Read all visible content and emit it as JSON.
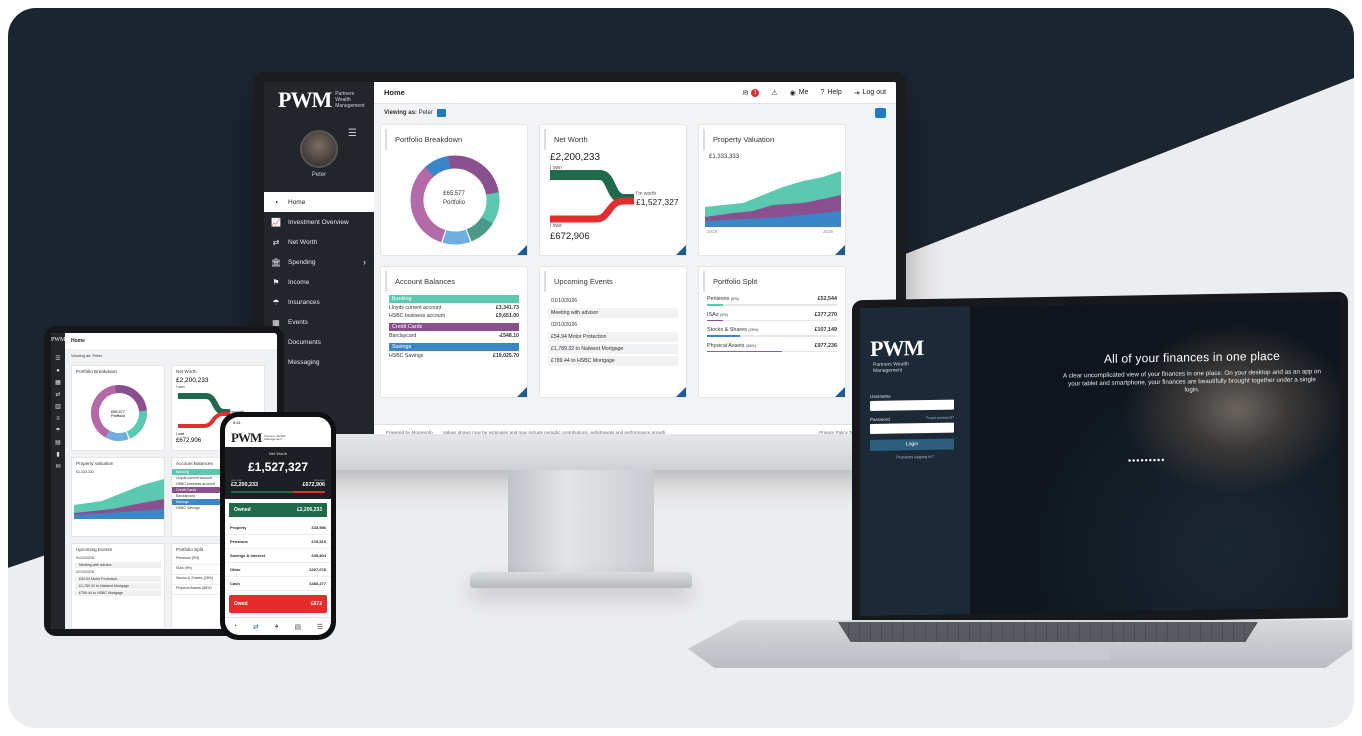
{
  "brand": {
    "logo": "PWM",
    "logo_sub": "Partners Wealth Management"
  },
  "monitor": {
    "top": {
      "title": "Home",
      "badge": "1",
      "me": "Me",
      "help": "Help",
      "logout": "Log out"
    },
    "viewing": {
      "label": "Viewing as:",
      "user": "Peter"
    },
    "user_name": "Peter",
    "nav": [
      {
        "label": "Home",
        "icon": "dashboard-icon"
      },
      {
        "label": "Investment Overview",
        "icon": "chart-line-icon"
      },
      {
        "label": "Net Worth",
        "icon": "transfer-icon"
      },
      {
        "label": "Spending",
        "icon": "bank-icon"
      },
      {
        "label": "Income",
        "icon": "signpost-icon"
      },
      {
        "label": "Insurances",
        "icon": "umbrella-icon"
      },
      {
        "label": "Events",
        "icon": "calendar-icon"
      },
      {
        "label": "Documents",
        "icon": "document-icon"
      },
      {
        "label": "Messaging",
        "icon": "message-icon"
      }
    ],
    "portfolio": {
      "title": "Portfolio Breakdown",
      "amount": "£65,577",
      "label": "Portfolio"
    },
    "networth": {
      "title": "Net Worth",
      "own_value": "£2,200,233",
      "own_label": "I own",
      "worth_label": "I'm worth",
      "worth_value": "£1,527,327",
      "owe_label": "I owe",
      "owe_value": "£672,906"
    },
    "property": {
      "title": "Property Valuation",
      "value": "£1,333,333",
      "start": "2019",
      "end": "2026"
    },
    "balances": {
      "title": "Account Balances",
      "groups": [
        {
          "name": "Banking",
          "color": "#5bc8b0",
          "rows": [
            [
              "Lloyds current account",
              "£3,341.73"
            ],
            [
              "HSBC business account",
              "£9,651.00"
            ]
          ]
        },
        {
          "name": "Credit Cards",
          "color": "#8a4f8f",
          "rows": [
            [
              "Barclaycard",
              "-£548.10"
            ]
          ]
        },
        {
          "name": "Savings",
          "color": "#3a86c8",
          "rows": [
            [
              "HSBC Savings",
              "£19,025.70"
            ]
          ]
        }
      ]
    },
    "events": {
      "title": "Upcoming Events",
      "items": [
        {
          "text": "01/10/2026",
          "box": false
        },
        {
          "text": "Meeting with advisor",
          "box": true
        },
        {
          "text": "02/10/2026",
          "box": false
        },
        {
          "text": "£54.94 Motor Protection",
          "box": true
        },
        {
          "text": "£1,789.32 to Natwest Mortgage",
          "box": true
        },
        {
          "text": "£789.44 to HSBC Mortgage",
          "box": true
        }
      ]
    },
    "split": {
      "title": "Portfolio Split",
      "items": [
        {
          "label": "Pensions",
          "pct": "(5%)",
          "value": "£52,544",
          "fill": 0.05,
          "color": "#5bc8b0"
        },
        {
          "label": "ISAs",
          "pct": "(9%)",
          "value": "£377,270",
          "fill": 0.09,
          "color": "#8a4f8f"
        },
        {
          "label": "Stocks & Shares",
          "pct": "(25%)",
          "value": "£107,149",
          "fill": 0.25,
          "color": "#3a86c8"
        },
        {
          "label": "Physical Assets",
          "pct": "(58%)",
          "value": "£977,236",
          "fill": 0.58,
          "color": "#a7539d"
        }
      ]
    },
    "footer": {
      "powered": "Powered by Moneyinfo",
      "disclaimer": "Values shown may be estimates and may include periodic contributions, withdrawals and performance growth",
      "links": "Privacy Policy  Terms & Conditio"
    }
  },
  "laptop": {
    "username_label": "Username",
    "password_label": "Password",
    "forgot": "Forgot password?",
    "login": "Login",
    "register": "Problems logging in?",
    "hero_title": "All of your finances in one place",
    "hero_text": "A clear uncomplicated view of your finances in one place. On your desktop and as an app on your tablet and smartphone, your finances are beautifully brought together under a single login.",
    "dots": "•••••••••"
  },
  "tablet": {
    "title": "Home",
    "viewing": "Viewing as: Peter",
    "portfolio_title": "Portfolio Breakdown",
    "portfolio_amount": "£65,577",
    "portfolio_label": "Portfolio",
    "networth_title": "Net Worth",
    "networth_value": "£2,200,233",
    "networth_own": "I own",
    "networth_worth": "I'm worth",
    "networth_owe": "I owe",
    "networth_owe_value": "£672,906",
    "property_title": "Property Valuation",
    "property_value": "£1,333,333",
    "balances_title": "Account Balances",
    "balances_rows": [
      "Banking",
      "Lloyds current account",
      "HSBC business account",
      "Credit Cards",
      "Barclaycard",
      "Savings",
      "HSBC Savings"
    ],
    "events_title": "Upcoming Events",
    "events_rows": [
      "01/10/2026",
      "Meeting with advisor",
      "02/10/2026",
      "£54.94 Motor Protection",
      "£1,789.32 to Natwest Mortgage",
      "£789.44 to HSBC Mortgage"
    ],
    "split_title": "Portfolio Split",
    "split_rows": [
      "Pensions (5%)",
      "ISAs (9%)",
      "Stocks & Shares (25%)",
      "Physical Assets (58%)"
    ]
  },
  "phone": {
    "time": "9:41",
    "title": "Net Worth",
    "worth": "£1,527,327",
    "own_label": "you own",
    "own_value": "£2,200,233",
    "owe_label": "you owe",
    "owe_value": "£672,906",
    "owned_label": "Owned",
    "owned_value": "£2,200,233",
    "rows": [
      [
        "Property",
        "£33,556"
      ],
      [
        "Pensions",
        "£19,515"
      ],
      [
        "Savings & Interest",
        "£35,804"
      ],
      [
        "Other",
        "£207,078"
      ],
      [
        "Cash",
        "£466,277"
      ]
    ],
    "owed_label": "Owed",
    "owed_value": "£672"
  },
  "colors": {
    "dark": "#1b2530",
    "teal": "#5bc8b0",
    "purple": "#8a4f8f",
    "blue": "#3a86c8",
    "green": "#1e6a4b",
    "red": "#e12d2d"
  }
}
